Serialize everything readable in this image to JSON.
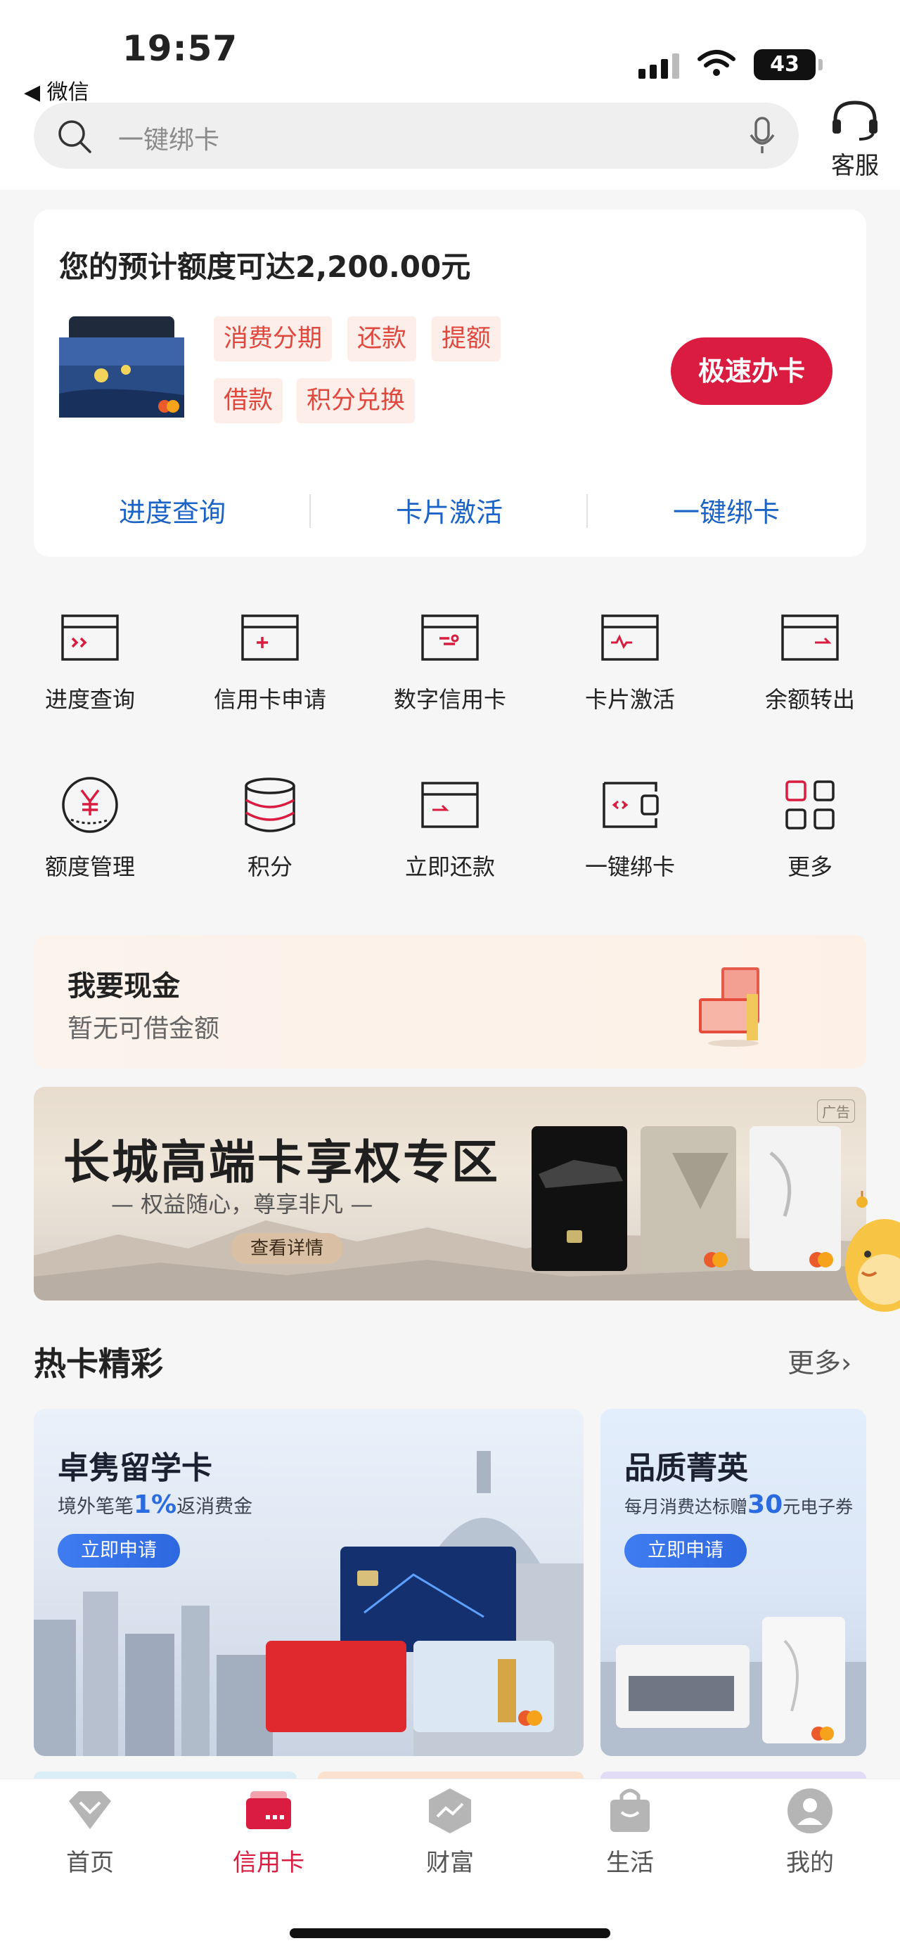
{
  "status": {
    "time": "19:57",
    "back": "◀ 微信",
    "battery": "43"
  },
  "search": {
    "placeholder": "一键绑卡",
    "service_label": "客服"
  },
  "panel": {
    "title": "您的预计额度可达2,200.00元",
    "tags": [
      "消费分期",
      "还款",
      "提额",
      "借款",
      "积分兑换"
    ],
    "apply": "极速办卡",
    "quick": [
      "进度查询",
      "卡片激活",
      "一键绑卡"
    ]
  },
  "grid": [
    {
      "label": "进度查询",
      "icon": "progress-card-icon"
    },
    {
      "label": "信用卡申请",
      "icon": "card-apply-icon"
    },
    {
      "label": "数字信用卡",
      "icon": "digital-card-icon"
    },
    {
      "label": "卡片激活",
      "icon": "card-activate-icon"
    },
    {
      "label": "余额转出",
      "icon": "balance-transfer-icon"
    },
    {
      "label": "额度管理",
      "icon": "yen-limit-icon"
    },
    {
      "label": "积分",
      "icon": "points-stack-icon"
    },
    {
      "label": "立即还款",
      "icon": "repay-card-icon"
    },
    {
      "label": "一键绑卡",
      "icon": "bind-card-icon"
    },
    {
      "label": "更多",
      "icon": "more-grid-icon"
    }
  ],
  "cash": {
    "title": "我要现金",
    "subtitle": "暂无可借金额"
  },
  "banner": {
    "title": "长城高端卡享权专区",
    "subtitle": "— 权益随心，尊享非凡 —",
    "button": "查看详情",
    "ad": "广告"
  },
  "hot": {
    "title": "热卡精彩",
    "more": "更多›",
    "cards": [
      {
        "title": "卓隽留学卡",
        "sub_pre": "境外笔笔",
        "sub_hl": "1%",
        "sub_post": "返消费金",
        "button": "立即申请"
      },
      {
        "title": "品质菁英",
        "sub_pre": "每月消费达标赠",
        "sub_hl": "30",
        "sub_post": "元电子券",
        "button": "立即申请"
      }
    ]
  },
  "nav": [
    {
      "label": "首页",
      "icon": "home-diamond-icon"
    },
    {
      "label": "信用卡",
      "icon": "credit-card-icon"
    },
    {
      "label": "财富",
      "icon": "wealth-chart-icon"
    },
    {
      "label": "生活",
      "icon": "shopping-bag-icon"
    },
    {
      "label": "我的",
      "icon": "profile-icon"
    }
  ],
  "colors": {
    "accent": "#d91c3f",
    "link": "#1b63c6",
    "tag_bg": "#fdeeea",
    "tag_text": "#e0483d"
  }
}
